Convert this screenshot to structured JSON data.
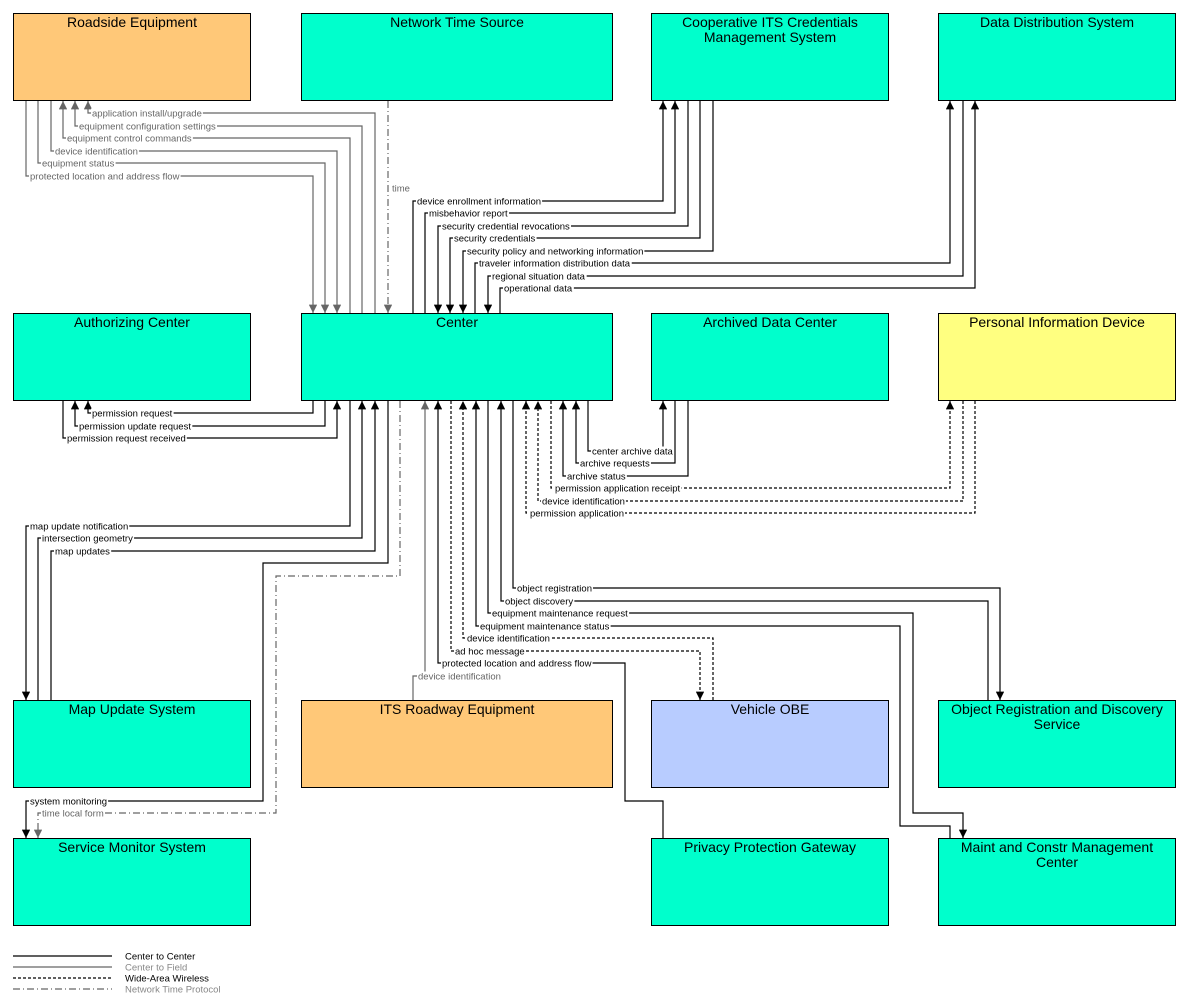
{
  "colors": {
    "field": "#ffc878",
    "center": "#00ffcc",
    "personal": "#ffff80",
    "vehicle": "#b8ccff",
    "center_to_center": "#000000",
    "center_to_field": "#666666",
    "wide_area_wireless": "#000000",
    "network_time_protocol": "#666666"
  },
  "boxes": [
    {
      "id": "rse",
      "name": "Roadside Equipment",
      "kind": "field"
    },
    {
      "id": "nts",
      "name": "Network Time Source",
      "kind": "center"
    },
    {
      "id": "cits",
      "name": "Cooperative ITS Credentials Management System",
      "kind": "center"
    },
    {
      "id": "dds",
      "name": "Data Distribution System",
      "kind": "center"
    },
    {
      "id": "auth",
      "name": "Authorizing Center",
      "kind": "center"
    },
    {
      "id": "center",
      "name": "Center",
      "kind": "center"
    },
    {
      "id": "adc",
      "name": "Archived Data Center",
      "kind": "center"
    },
    {
      "id": "pid",
      "name": "Personal Information Device",
      "kind": "personal"
    },
    {
      "id": "mus",
      "name": "Map Update System",
      "kind": "center"
    },
    {
      "id": "itsre",
      "name": "ITS Roadway Equipment",
      "kind": "field"
    },
    {
      "id": "obe",
      "name": "Vehicle OBE",
      "kind": "vehicle"
    },
    {
      "id": "ords",
      "name": "Object Registration and Discovery Service",
      "kind": "center"
    },
    {
      "id": "sms",
      "name": "Service Monitor System",
      "kind": "center"
    },
    {
      "id": "ppg",
      "name": "Privacy Protection Gateway",
      "kind": "center"
    },
    {
      "id": "mcm",
      "name": "Maint and Constr Management Center",
      "kind": "center"
    }
  ],
  "flows": [
    {
      "label": "application install/upgrade",
      "from": "center",
      "to": "rse",
      "type": "center_to_field"
    },
    {
      "label": "equipment configuration settings",
      "from": "center",
      "to": "rse",
      "type": "center_to_field"
    },
    {
      "label": "equipment control commands",
      "from": "center",
      "to": "rse",
      "type": "center_to_field"
    },
    {
      "label": "device identification",
      "from": "rse",
      "to": "center",
      "type": "center_to_field"
    },
    {
      "label": "equipment status",
      "from": "rse",
      "to": "center",
      "type": "center_to_field"
    },
    {
      "label": "protected location and address flow",
      "from": "rse",
      "to": "center",
      "type": "center_to_field"
    },
    {
      "label": "time",
      "from": "nts",
      "to": "center",
      "type": "network_time_protocol"
    },
    {
      "label": "device enrollment information",
      "from": "center",
      "to": "cits",
      "type": "center_to_center"
    },
    {
      "label": "misbehavior report",
      "from": "center",
      "to": "cits",
      "type": "center_to_center"
    },
    {
      "label": "security credential revocations",
      "from": "cits",
      "to": "center",
      "type": "center_to_center"
    },
    {
      "label": "security credentials",
      "from": "cits",
      "to": "center",
      "type": "center_to_center"
    },
    {
      "label": "security policy and networking information",
      "from": "cits",
      "to": "center",
      "type": "center_to_center"
    },
    {
      "label": "traveler information distribution data",
      "from": "center",
      "to": "dds",
      "type": "center_to_center"
    },
    {
      "label": "regional situation data",
      "from": "dds",
      "to": "center",
      "type": "center_to_center"
    },
    {
      "label": "operational data",
      "from": "center",
      "to": "dds",
      "type": "center_to_center"
    },
    {
      "label": "permission request",
      "from": "center",
      "to": "auth",
      "type": "center_to_center"
    },
    {
      "label": "permission update request",
      "from": "center",
      "to": "auth",
      "type": "center_to_center"
    },
    {
      "label": "permission request received",
      "from": "auth",
      "to": "center",
      "type": "center_to_center"
    },
    {
      "label": "center archive data",
      "from": "center",
      "to": "adc",
      "type": "center_to_center"
    },
    {
      "label": "archive requests",
      "from": "adc",
      "to": "center",
      "type": "center_to_center"
    },
    {
      "label": "archive status",
      "from": "adc",
      "to": "center",
      "type": "center_to_center"
    },
    {
      "label": "permission application receipt",
      "from": "center",
      "to": "pid",
      "type": "wide_area_wireless"
    },
    {
      "label": "device identification",
      "from": "pid",
      "to": "center",
      "type": "wide_area_wireless"
    },
    {
      "label": "permission application",
      "from": "pid",
      "to": "center",
      "type": "wide_area_wireless"
    },
    {
      "label": "map update notification",
      "from": "center",
      "to": "mus",
      "type": "center_to_center"
    },
    {
      "label": "intersection geometry",
      "from": "mus",
      "to": "center",
      "type": "center_to_center"
    },
    {
      "label": "map updates",
      "from": "mus",
      "to": "center",
      "type": "center_to_center"
    },
    {
      "label": "system monitoring",
      "from": "center",
      "to": "sms",
      "type": "center_to_center"
    },
    {
      "label": "time local form",
      "from": "center",
      "to": "sms",
      "type": "network_time_protocol"
    },
    {
      "label": "object registration",
      "from": "center",
      "to": "ords",
      "type": "center_to_center"
    },
    {
      "label": "object discovery",
      "from": "ords",
      "to": "center",
      "type": "center_to_center"
    },
    {
      "label": "equipment maintenance request",
      "from": "center",
      "to": "mcm",
      "type": "center_to_center"
    },
    {
      "label": "equipment maintenance status",
      "from": "mcm",
      "to": "center",
      "type": "center_to_center"
    },
    {
      "label": "device identification",
      "from": "obe",
      "to": "center",
      "type": "wide_area_wireless"
    },
    {
      "label": "ad hoc message",
      "from": "center",
      "to": "obe",
      "type": "wide_area_wireless"
    },
    {
      "label": "protected location and address flow",
      "from": "ppg",
      "to": "center",
      "type": "center_to_center"
    },
    {
      "label": "device identification",
      "from": "itsre",
      "to": "center",
      "type": "center_to_field"
    }
  ],
  "legend": [
    {
      "label": "Center to Center",
      "type": "center_to_center"
    },
    {
      "label": "Center to Field",
      "type": "center_to_field"
    },
    {
      "label": "Wide-Area Wireless",
      "type": "wide_area_wireless"
    },
    {
      "label": "Network Time Protocol",
      "type": "network_time_protocol"
    }
  ]
}
